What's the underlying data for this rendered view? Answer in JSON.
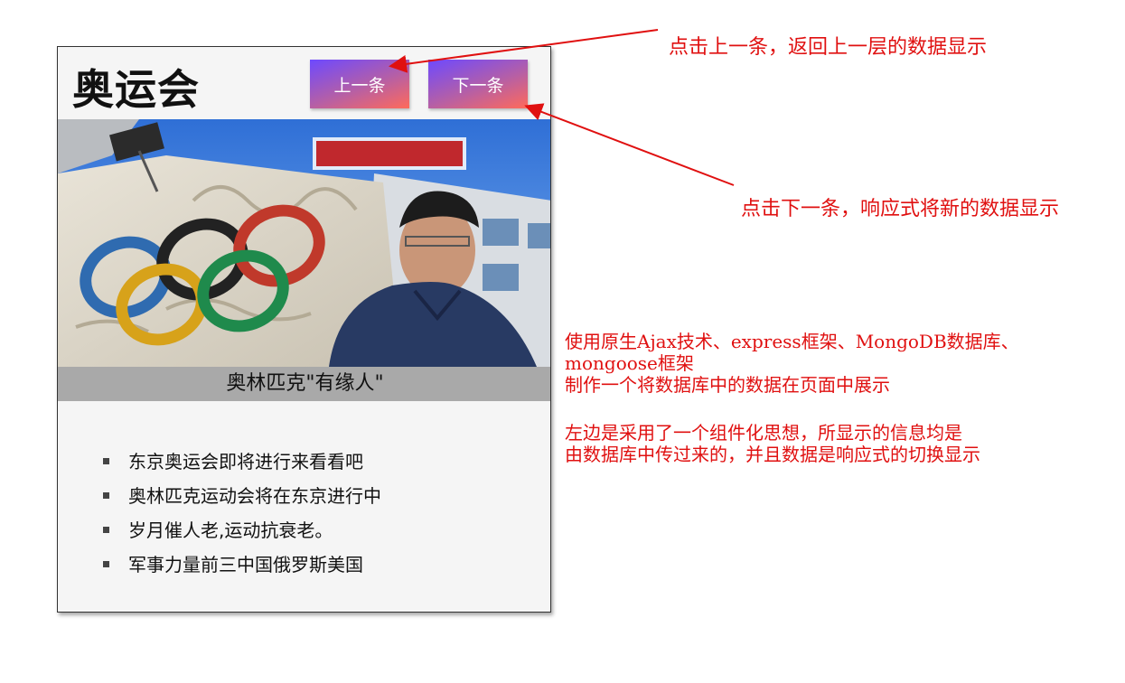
{
  "card": {
    "title": "奥运会",
    "prev_button": "上一条",
    "next_button": "下一条",
    "image_label": "",
    "caption": "奥林匹克\"有缘人\"",
    "news": [
      "东京奥运会即将进行来看看吧",
      "奥林匹克运动会将在东京进行中",
      "岁月催人老,运动抗衰老。",
      "军事力量前三中国俄罗斯美国"
    ]
  },
  "annotations": {
    "prev_note": "点击上一条，返回上一层的数据显示",
    "next_note": "点击下一条，响应式将新的数据显示",
    "desc_line1": "使用原生Ajax技术、express框架、MongoDB数据库、",
    "desc_line2": "mongoose框架",
    "desc_line3": "制作一个将数据库中的数据在页面中展示",
    "desc_line4": "左边是采用了一个组件化思想，所显示的信息均是",
    "desc_line5": "由数据库中传过来的，并且数据是响应式的切换显示"
  },
  "colors": {
    "annotation": "#e01010",
    "button_gradient_start": "#6d49ff",
    "button_gradient_end": "#ff6a5a",
    "caption_bg": "#a9a9a9"
  }
}
